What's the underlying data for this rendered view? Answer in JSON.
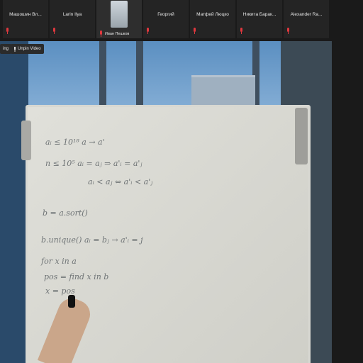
{
  "participants": [
    {
      "name": "Машошин Вл..."
    },
    {
      "name": "Larin Ilya"
    },
    {
      "name": "Иван Пешков"
    },
    {
      "name": "Георгий"
    },
    {
      "name": "Матфей Люцко"
    },
    {
      "name": "Никита Барак..."
    },
    {
      "name": "Alexander Ra..."
    }
  ],
  "stage": {
    "recording_label": "ing",
    "unpin_label": "Unpin Video"
  },
  "board_lines": [
    "aᵢ ≤ 10¹⁸      a → a'",
    "n ≤ 10⁵      aᵢ = aⱼ ⇒ a'ᵢ = a'ⱼ",
    "aᵢ < aⱼ ⇔ a'ᵢ < a'ⱼ",
    "b = a.sort()",
    "b.unique()     aᵢ = bⱼ → a'ᵢ = j",
    "for x in a",
    "pos = find x in b",
    "x = pos"
  ],
  "colors": {
    "accent_mute": "#e0383e"
  }
}
